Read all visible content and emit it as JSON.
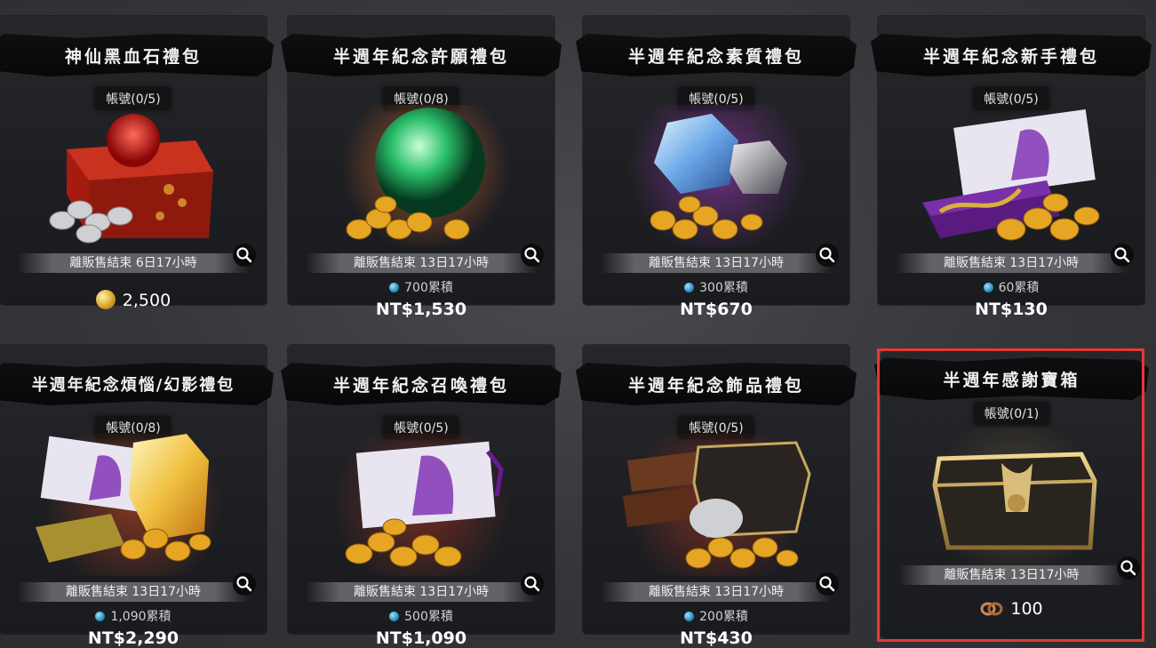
{
  "packs": [
    {
      "title": "神仙黑血石禮包",
      "account": "帳號(0/5)",
      "timer": "離販售結束 6日17小時",
      "accumulate": "",
      "price": "2,500",
      "price_type": "coin"
    },
    {
      "title": "半週年紀念許願禮包",
      "account": "帳號(0/8)",
      "timer": "離販售結束 13日17小時",
      "accumulate": "700累積",
      "price": "NT$1,530",
      "price_type": "cash"
    },
    {
      "title": "半週年紀念素質禮包",
      "account": "帳號(0/5)",
      "timer": "離販售結束 13日17小時",
      "accumulate": "300累積",
      "price": "NT$670",
      "price_type": "cash"
    },
    {
      "title": "半週年紀念新手禮包",
      "account": "帳號(0/5)",
      "timer": "離販售結束 13日17小時",
      "accumulate": "60累積",
      "price": "NT$130",
      "price_type": "cash"
    },
    {
      "title": "半週年紀念煩惱/幻影禮包",
      "account": "帳號(0/8)",
      "timer": "離販售結束 13日17小時",
      "accumulate": "1,090累積",
      "price": "NT$2,290",
      "price_type": "cash"
    },
    {
      "title": "半週年紀念召喚禮包",
      "account": "帳號(0/5)",
      "timer": "離販售結束 13日17小時",
      "accumulate": "500累積",
      "price": "NT$1,090",
      "price_type": "cash"
    },
    {
      "title": "半週年紀念飾品禮包",
      "account": "帳號(0/5)",
      "timer": "離販售結束 13日17小時",
      "accumulate": "200累積",
      "price": "NT$430",
      "price_type": "cash"
    },
    {
      "title": "半週年感謝寶箱",
      "account": "帳號(0/1)",
      "timer": "離販售結束 13日17小時",
      "accumulate": "",
      "price": "100",
      "price_type": "ring"
    }
  ],
  "highlight_color": "#e53935",
  "icons": {
    "zoom": "magnifier-icon",
    "accumulate": "gem-icon",
    "coin": "gold-coin-icon",
    "ring": "bronze-ring-icon"
  }
}
